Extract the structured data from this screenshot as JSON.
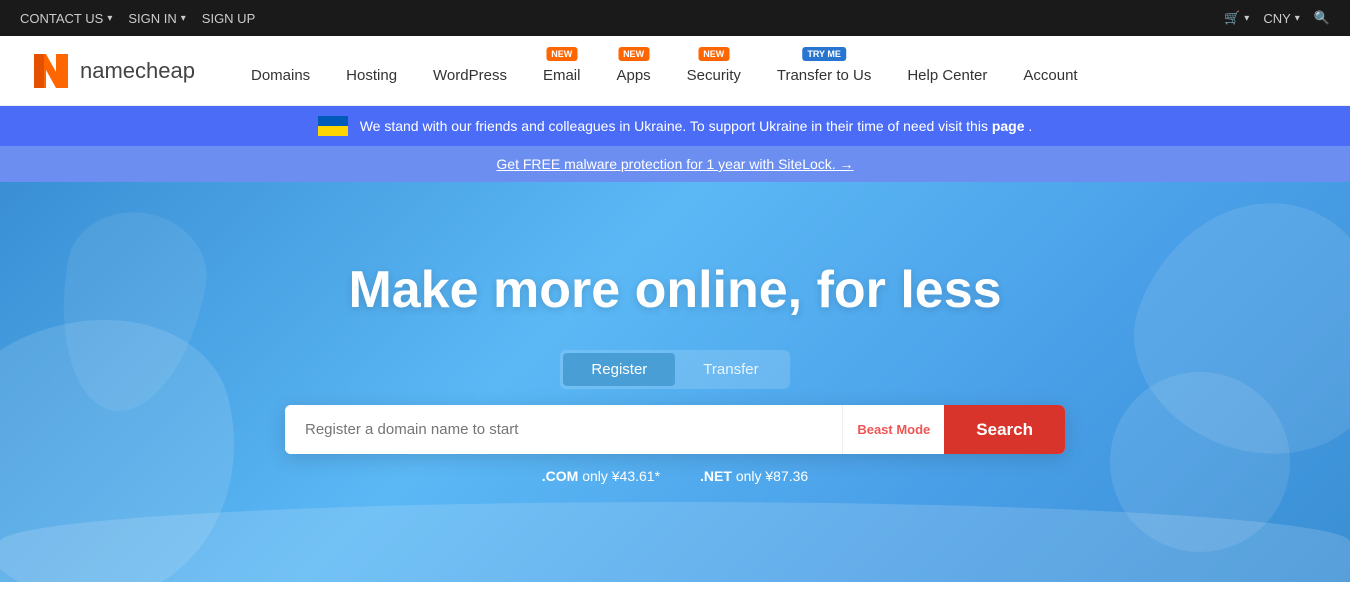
{
  "topbar": {
    "contact_label": "CONTACT US",
    "signin_label": "SIGN IN",
    "signup_label": "SIGN UP",
    "cart_label": "CNY",
    "search_icon": "🔍"
  },
  "navbar": {
    "logo_text": "namecheap",
    "links": [
      {
        "id": "domains",
        "label": "Domains",
        "badge": null
      },
      {
        "id": "hosting",
        "label": "Hosting",
        "badge": null
      },
      {
        "id": "wordpress",
        "label": "WordPress",
        "badge": null
      },
      {
        "id": "email",
        "label": "Email",
        "badge": {
          "text": "NEW",
          "color": "orange"
        }
      },
      {
        "id": "apps",
        "label": "Apps",
        "badge": {
          "text": "NEW",
          "color": "orange"
        }
      },
      {
        "id": "security",
        "label": "Security",
        "badge": {
          "text": "NEW",
          "color": "orange"
        }
      },
      {
        "id": "transfer",
        "label": "Transfer to Us",
        "badge": {
          "text": "TRY ME",
          "color": "blue"
        }
      },
      {
        "id": "helpcenter",
        "label": "Help Center",
        "badge": null
      },
      {
        "id": "account",
        "label": "Account",
        "badge": null
      }
    ]
  },
  "ukraine_banner": {
    "text_before": "We stand with our friends and colleagues in Ukraine. To support Ukraine in their time of need visit this",
    "link_text": "page",
    "text_after": "."
  },
  "promo_bar": {
    "text": "Get FREE malware protection for 1 year with SiteLock. →"
  },
  "hero": {
    "title": "Make more online, for less",
    "tabs": [
      {
        "id": "register",
        "label": "Register",
        "active": true
      },
      {
        "id": "transfer",
        "label": "Transfer",
        "active": false
      }
    ],
    "search_placeholder": "Register a domain name to start",
    "beast_mode_label": "Beast Mode",
    "search_button_label": "Search",
    "domain_prices": [
      {
        "tld": ".COM",
        "price": "only ¥43.61*"
      },
      {
        "tld": ".NET",
        "price": "only ¥87.36"
      }
    ]
  }
}
